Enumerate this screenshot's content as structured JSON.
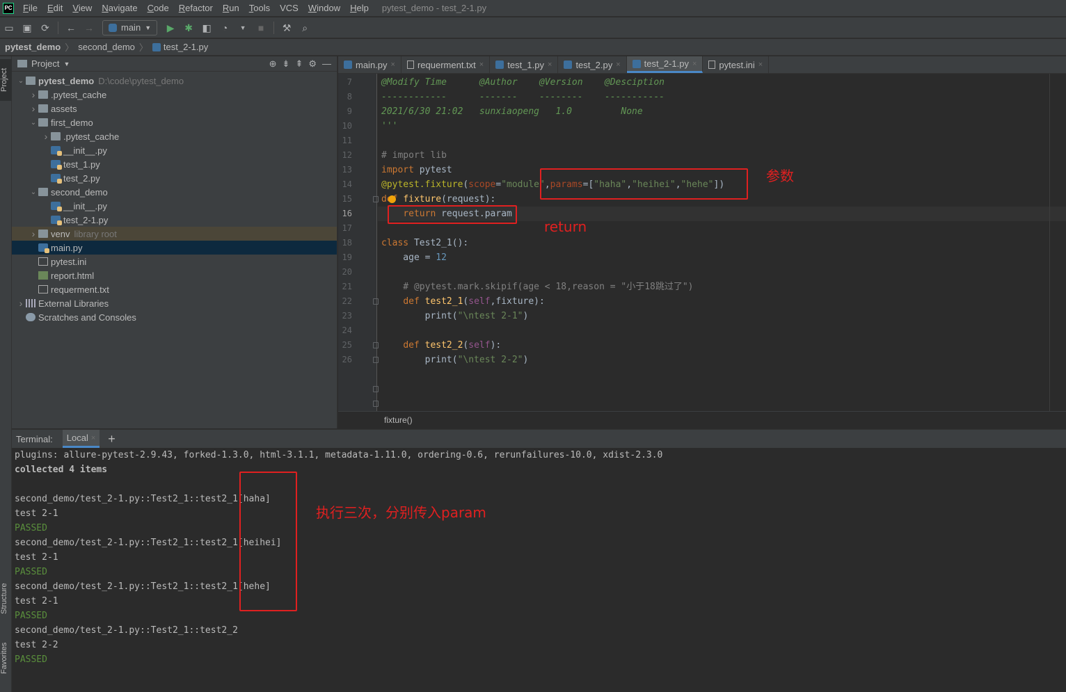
{
  "menubar": {
    "logo": "PC",
    "items": [
      {
        "mnemonic": "F",
        "rest": "ile"
      },
      {
        "mnemonic": "E",
        "rest": "dit"
      },
      {
        "mnemonic": "V",
        "rest": "iew"
      },
      {
        "mnemonic": "N",
        "rest": "avigate"
      },
      {
        "mnemonic": "C",
        "rest": "ode"
      },
      {
        "mnemonic": "R",
        "rest": "efactor"
      },
      {
        "mnemonic": "R",
        "rest": "un"
      },
      {
        "mnemonic": "T",
        "rest": "ools"
      },
      {
        "mnemonic": "",
        "rest": "VCS"
      },
      {
        "mnemonic": "W",
        "rest": "indow"
      },
      {
        "mnemonic": "H",
        "rest": "elp"
      }
    ],
    "window_title": "pytest_demo - test_2-1.py"
  },
  "toolbar": {
    "run_config": "main"
  },
  "breadcrumb": [
    "pytest_demo",
    "second_demo",
    "test_2-1.py"
  ],
  "left_strip": {
    "project": "Project",
    "structure": "Structure",
    "favorites": "Favorites"
  },
  "project_panel": {
    "title": "Project",
    "tree": [
      {
        "label": "pytest_demo",
        "extra": "D:\\code\\pytest_demo",
        "type": "folder",
        "arrow": "open"
      },
      {
        "label": ".pytest_cache",
        "extra": "",
        "type": "folder",
        "arrow": "closed"
      },
      {
        "label": "assets",
        "extra": "",
        "type": "folder",
        "arrow": "closed"
      },
      {
        "label": "first_demo",
        "extra": "",
        "type": "folder",
        "arrow": "open"
      },
      {
        "label": ".pytest_cache",
        "extra": "",
        "type": "folder",
        "arrow": "closed"
      },
      {
        "label": "__init__.py",
        "extra": "",
        "type": "py",
        "arrow": ""
      },
      {
        "label": "test_1.py",
        "extra": "",
        "type": "py",
        "arrow": ""
      },
      {
        "label": "test_2.py",
        "extra": "",
        "type": "py",
        "arrow": ""
      },
      {
        "label": "second_demo",
        "extra": "",
        "type": "folder",
        "arrow": "open"
      },
      {
        "label": "__init__.py",
        "extra": "",
        "type": "py",
        "arrow": ""
      },
      {
        "label": "test_2-1.py",
        "extra": "",
        "type": "py",
        "arrow": ""
      },
      {
        "label": "venv",
        "extra": "library root",
        "type": "folder",
        "arrow": "closed"
      },
      {
        "label": "main.py",
        "extra": "",
        "type": "py",
        "arrow": ""
      },
      {
        "label": "pytest.ini",
        "extra": "",
        "type": "txt",
        "arrow": ""
      },
      {
        "label": "report.html",
        "extra": "",
        "type": "html",
        "arrow": ""
      },
      {
        "label": "requerment.txt",
        "extra": "",
        "type": "txt",
        "arrow": ""
      },
      {
        "label": "External Libraries",
        "extra": "",
        "type": "lib",
        "arrow": "closed"
      },
      {
        "label": "Scratches and Consoles",
        "extra": "",
        "type": "scratch",
        "arrow": ""
      }
    ]
  },
  "editor_tabs": [
    {
      "label": "main.py",
      "type": "py"
    },
    {
      "label": "requerment.txt",
      "type": "txt"
    },
    {
      "label": "test_1.py",
      "type": "py"
    },
    {
      "label": "test_2.py",
      "type": "py"
    },
    {
      "label": "test_2-1.py",
      "type": "py"
    },
    {
      "label": "pytest.ini",
      "type": "txt"
    }
  ],
  "editor": {
    "line_numbers": [
      "7",
      "8",
      "9",
      "10",
      "11",
      "12",
      "13",
      "14",
      "15",
      "16",
      "17",
      "18",
      "19",
      "20",
      "21",
      "22",
      "23",
      "24",
      "25",
      "26"
    ],
    "current_line": "16",
    "lines": [
      [
        [
          "doc",
          "@Modify Time      @Author    @Version    @Desciption"
        ]
      ],
      [
        [
          "doc",
          "------------      -------    --------    -----------"
        ]
      ],
      [
        [
          "doc",
          "2021/6/30 21:02   sunxiaopeng   1.0         None"
        ]
      ],
      [
        [
          "doc",
          "'''"
        ]
      ],
      [],
      [
        [
          "cmt",
          "# import lib"
        ]
      ],
      [
        [
          "kw",
          "import "
        ],
        [
          "",
          "pytest"
        ]
      ],
      [
        [
          "dec",
          "@pytest.fixture"
        ],
        [
          "",
          "("
        ],
        [
          "param",
          "scope"
        ],
        [
          "",
          "="
        ],
        [
          "str",
          "\"module\""
        ],
        [
          "",
          ","
        ],
        [
          "param",
          "params"
        ],
        [
          "",
          "=["
        ],
        [
          "str",
          "\"haha\""
        ],
        [
          "",
          ","
        ],
        [
          "str",
          "\"heihei\""
        ],
        [
          "",
          ","
        ],
        [
          "str",
          "\"hehe\""
        ],
        [
          "",
          "])"
        ]
      ],
      [
        [
          "kw",
          "def "
        ],
        [
          "fn",
          "fixture"
        ],
        [
          "",
          "(request):"
        ]
      ],
      [
        [
          "",
          "    "
        ],
        [
          "kw",
          "return "
        ],
        [
          "",
          "request.param"
        ]
      ],
      [],
      [
        [
          "kw",
          "class "
        ],
        [
          "",
          "Test2_1():"
        ]
      ],
      [
        [
          "",
          "    age = "
        ],
        [
          "num",
          "12"
        ]
      ],
      [],
      [
        [
          "cmt",
          "    # @pytest.mark.skipif(age < 18,reason = \"小于18跳过了\")"
        ]
      ],
      [
        [
          "",
          "    "
        ],
        [
          "kw",
          "def "
        ],
        [
          "fn",
          "test2_1"
        ],
        [
          "",
          "("
        ],
        [
          "selfk",
          "self"
        ],
        [
          "",
          ",fixture):"
        ]
      ],
      [
        [
          "",
          "        print("
        ],
        [
          "str",
          "\"\\ntest 2-1\""
        ],
        [
          "",
          ")"
        ]
      ],
      [],
      [
        [
          "",
          "    "
        ],
        [
          "kw",
          "def "
        ],
        [
          "fn",
          "test2_2"
        ],
        [
          "",
          "("
        ],
        [
          "selfk",
          "self"
        ],
        [
          "",
          "):"
        ]
      ],
      [
        [
          "",
          "        print("
        ],
        [
          "str",
          "\"\\ntest 2-2\""
        ],
        [
          "",
          ")"
        ]
      ]
    ]
  },
  "editor_breadcrumb": "fixture()",
  "terminal": {
    "label": "Terminal:",
    "tab": "Local",
    "lines": [
      {
        "text": "plugins: allure-pytest-2.9.43, forked-1.3.0, html-3.1.1, metadata-1.11.0, ordering-0.6, rerunfailures-10.0, xdist-2.3.0",
        "style": ""
      },
      {
        "text": "collected 4 items",
        "style": "bold"
      },
      {
        "text": "",
        "style": ""
      },
      {
        "text": "second_demo/test_2-1.py::Test2_1::test2_1[haha]",
        "style": ""
      },
      {
        "text": "test 2-1",
        "style": ""
      },
      {
        "text": "PASSED",
        "style": "passed"
      },
      {
        "text": "second_demo/test_2-1.py::Test2_1::test2_1[heihei]",
        "style": ""
      },
      {
        "text": "test 2-1",
        "style": ""
      },
      {
        "text": "PASSED",
        "style": "passed"
      },
      {
        "text": "second_demo/test_2-1.py::Test2_1::test2_1[hehe]",
        "style": ""
      },
      {
        "text": "test 2-1",
        "style": ""
      },
      {
        "text": "PASSED",
        "style": "passed"
      },
      {
        "text": "second_demo/test_2-1.py::Test2_1::test2_2",
        "style": ""
      },
      {
        "text": "test 2-2",
        "style": ""
      },
      {
        "text": "PASSED",
        "style": "passed"
      }
    ]
  },
  "annotations": {
    "params_label": "参数",
    "return_label": "return",
    "exec_label": "执行三次，分别传入param"
  },
  "colors": {
    "annotation_red": "#e02020",
    "passed_green": "#5a8f3c",
    "selection_blue": "#0d293e"
  }
}
